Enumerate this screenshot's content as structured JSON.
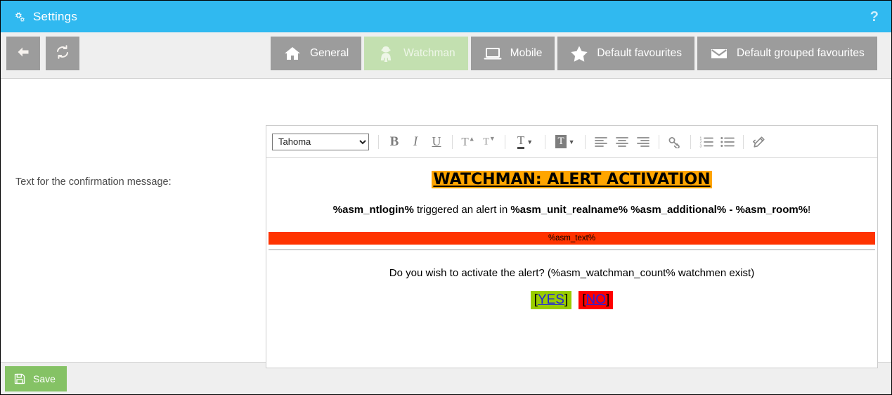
{
  "window": {
    "title": "Settings",
    "title_icon": "gears-icon",
    "help_label": "?"
  },
  "toolbar": {
    "back_icon": "arrow-left-icon",
    "refresh_icon": "refresh-icon",
    "tabs": [
      {
        "label": "General",
        "icon": "home-icon",
        "active": false
      },
      {
        "label": "Watchman",
        "icon": "spy-icon",
        "active": true
      },
      {
        "label": "Mobile",
        "icon": "laptop-icon",
        "active": false
      },
      {
        "label": "Default favourites",
        "icon": "star-icon",
        "active": false
      },
      {
        "label": "Default grouped favourites",
        "icon": "envelope-icon",
        "active": false
      }
    ]
  },
  "form": {
    "field_label": "Text for the confirmation message:"
  },
  "editor": {
    "font_select_value": "Tahoma",
    "font_options": [
      "Tahoma"
    ],
    "buttons": [
      {
        "name": "bold-button",
        "glyph": "B"
      },
      {
        "name": "italic-button",
        "glyph": "I"
      },
      {
        "name": "underline-button",
        "glyph": "U"
      },
      {
        "name": "superscript-button",
        "glyph": "T"
      },
      {
        "name": "subscript-button",
        "glyph": "T"
      },
      {
        "name": "text-color-button",
        "glyph": "T"
      },
      {
        "name": "highlight-color-button",
        "glyph": "T"
      },
      {
        "name": "align-left-button",
        "glyph": "align-left-icon"
      },
      {
        "name": "align-center-button",
        "glyph": "align-center-icon"
      },
      {
        "name": "align-right-button",
        "glyph": "align-right-icon"
      },
      {
        "name": "link-button",
        "glyph": "chain-link-icon"
      },
      {
        "name": "ordered-list-button",
        "glyph": "numbered-list-icon"
      },
      {
        "name": "unordered-list-button",
        "glyph": "bullet-list-icon"
      },
      {
        "name": "clean-format-button",
        "glyph": "pencil-code-icon"
      }
    ],
    "content": {
      "title": "WATCHMAN: ALERT ACTIVATION",
      "line2_part1": "%asm_ntlogin%",
      "line2_part2": " triggered an alert in ",
      "line2_part3": "%asm_unit_realname% %asm_additional% - %asm_room%",
      "line2_part4": "!",
      "alert_bar_text": "%asm_text%",
      "question": "Do you wish to activate the alert? (%asm_watchman_count% watchmen exist)",
      "yes_bracket_open": "[",
      "yes_label": "YES",
      "yes_bracket_close": "]",
      "no_bracket_open": "[",
      "no_label": "NO",
      "no_bracket_close": "]"
    }
  },
  "footer": {
    "save_label": "Save",
    "save_icon": "floppy-disk-icon"
  },
  "colors": {
    "titlebar": "#30b9f0",
    "tab_inactive": "#9c9c9c",
    "tab_active": "#c3e0b0",
    "save_green": "#85c265",
    "highlight_orange": "#ffa500",
    "alert_red": "#ff3300",
    "yes_green": "#99cc00",
    "no_red": "#ff0000",
    "link_blue": "#2222dd"
  }
}
